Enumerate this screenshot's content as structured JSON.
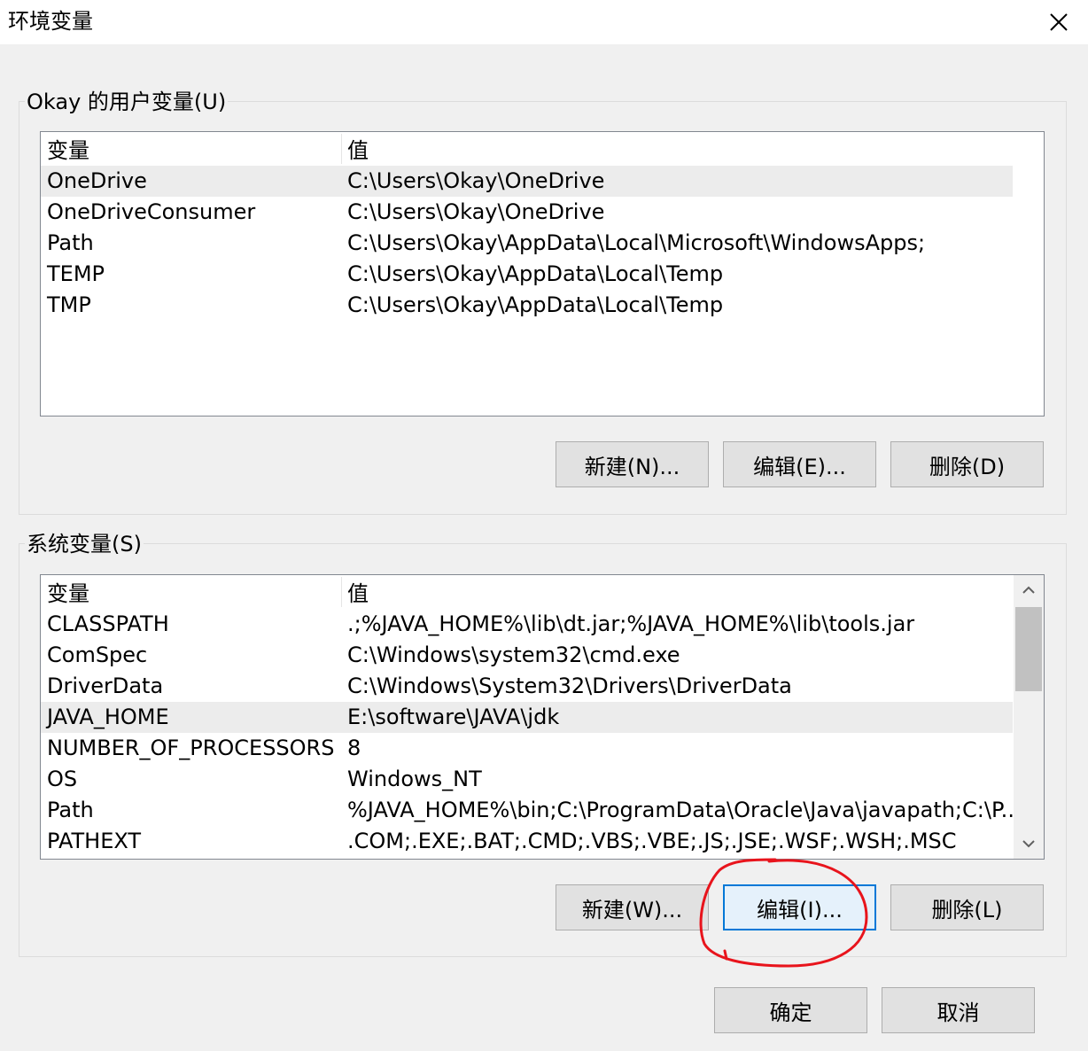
{
  "window": {
    "title": "环境变量"
  },
  "user_vars": {
    "label": "Okay 的用户变量(U)",
    "headers": {
      "name": "变量",
      "value": "值"
    },
    "rows": [
      {
        "name": "OneDrive",
        "value": "C:\\Users\\Okay\\OneDrive",
        "selected": true
      },
      {
        "name": "OneDriveConsumer",
        "value": "C:\\Users\\Okay\\OneDrive",
        "selected": false
      },
      {
        "name": "Path",
        "value": "C:\\Users\\Okay\\AppData\\Local\\Microsoft\\WindowsApps;",
        "selected": false
      },
      {
        "name": "TEMP",
        "value": "C:\\Users\\Okay\\AppData\\Local\\Temp",
        "selected": false
      },
      {
        "name": "TMP",
        "value": "C:\\Users\\Okay\\AppData\\Local\\Temp",
        "selected": false
      }
    ],
    "buttons": {
      "new": "新建(N)...",
      "edit": "编辑(E)...",
      "delete": "删除(D)"
    }
  },
  "system_vars": {
    "label": "系统变量(S)",
    "headers": {
      "name": "变量",
      "value": "值"
    },
    "rows": [
      {
        "name": "CLASSPATH",
        "value": ".;%JAVA_HOME%\\lib\\dt.jar;%JAVA_HOME%\\lib\\tools.jar",
        "selected": false
      },
      {
        "name": "ComSpec",
        "value": "C:\\Windows\\system32\\cmd.exe",
        "selected": false
      },
      {
        "name": "DriverData",
        "value": "C:\\Windows\\System32\\Drivers\\DriverData",
        "selected": false
      },
      {
        "name": "JAVA_HOME",
        "value": "E:\\software\\JAVA\\jdk",
        "selected": true
      },
      {
        "name": "NUMBER_OF_PROCESSORS",
        "value": "8",
        "selected": false
      },
      {
        "name": "OS",
        "value": "Windows_NT",
        "selected": false
      },
      {
        "name": "Path",
        "value": "%JAVA_HOME%\\bin;C:\\ProgramData\\Oracle\\Java\\javapath;C:\\P...",
        "selected": false
      },
      {
        "name": "PATHEXT",
        "value": ".COM;.EXE;.BAT;.CMD;.VBS;.VBE;.JS;.JSE;.WSF;.WSH;.MSC",
        "selected": false
      }
    ],
    "buttons": {
      "new": "新建(W)...",
      "edit": "编辑(I)...",
      "delete": "删除(L)"
    }
  },
  "footer": {
    "ok": "确定",
    "cancel": "取消"
  },
  "icons": {
    "close": "close-icon",
    "scroll_up": "chevron-up-icon",
    "scroll_down": "chevron-down-icon"
  },
  "colors": {
    "focus_border": "#0078d7",
    "annotation": "#e8141c",
    "selection": "#ececec"
  }
}
